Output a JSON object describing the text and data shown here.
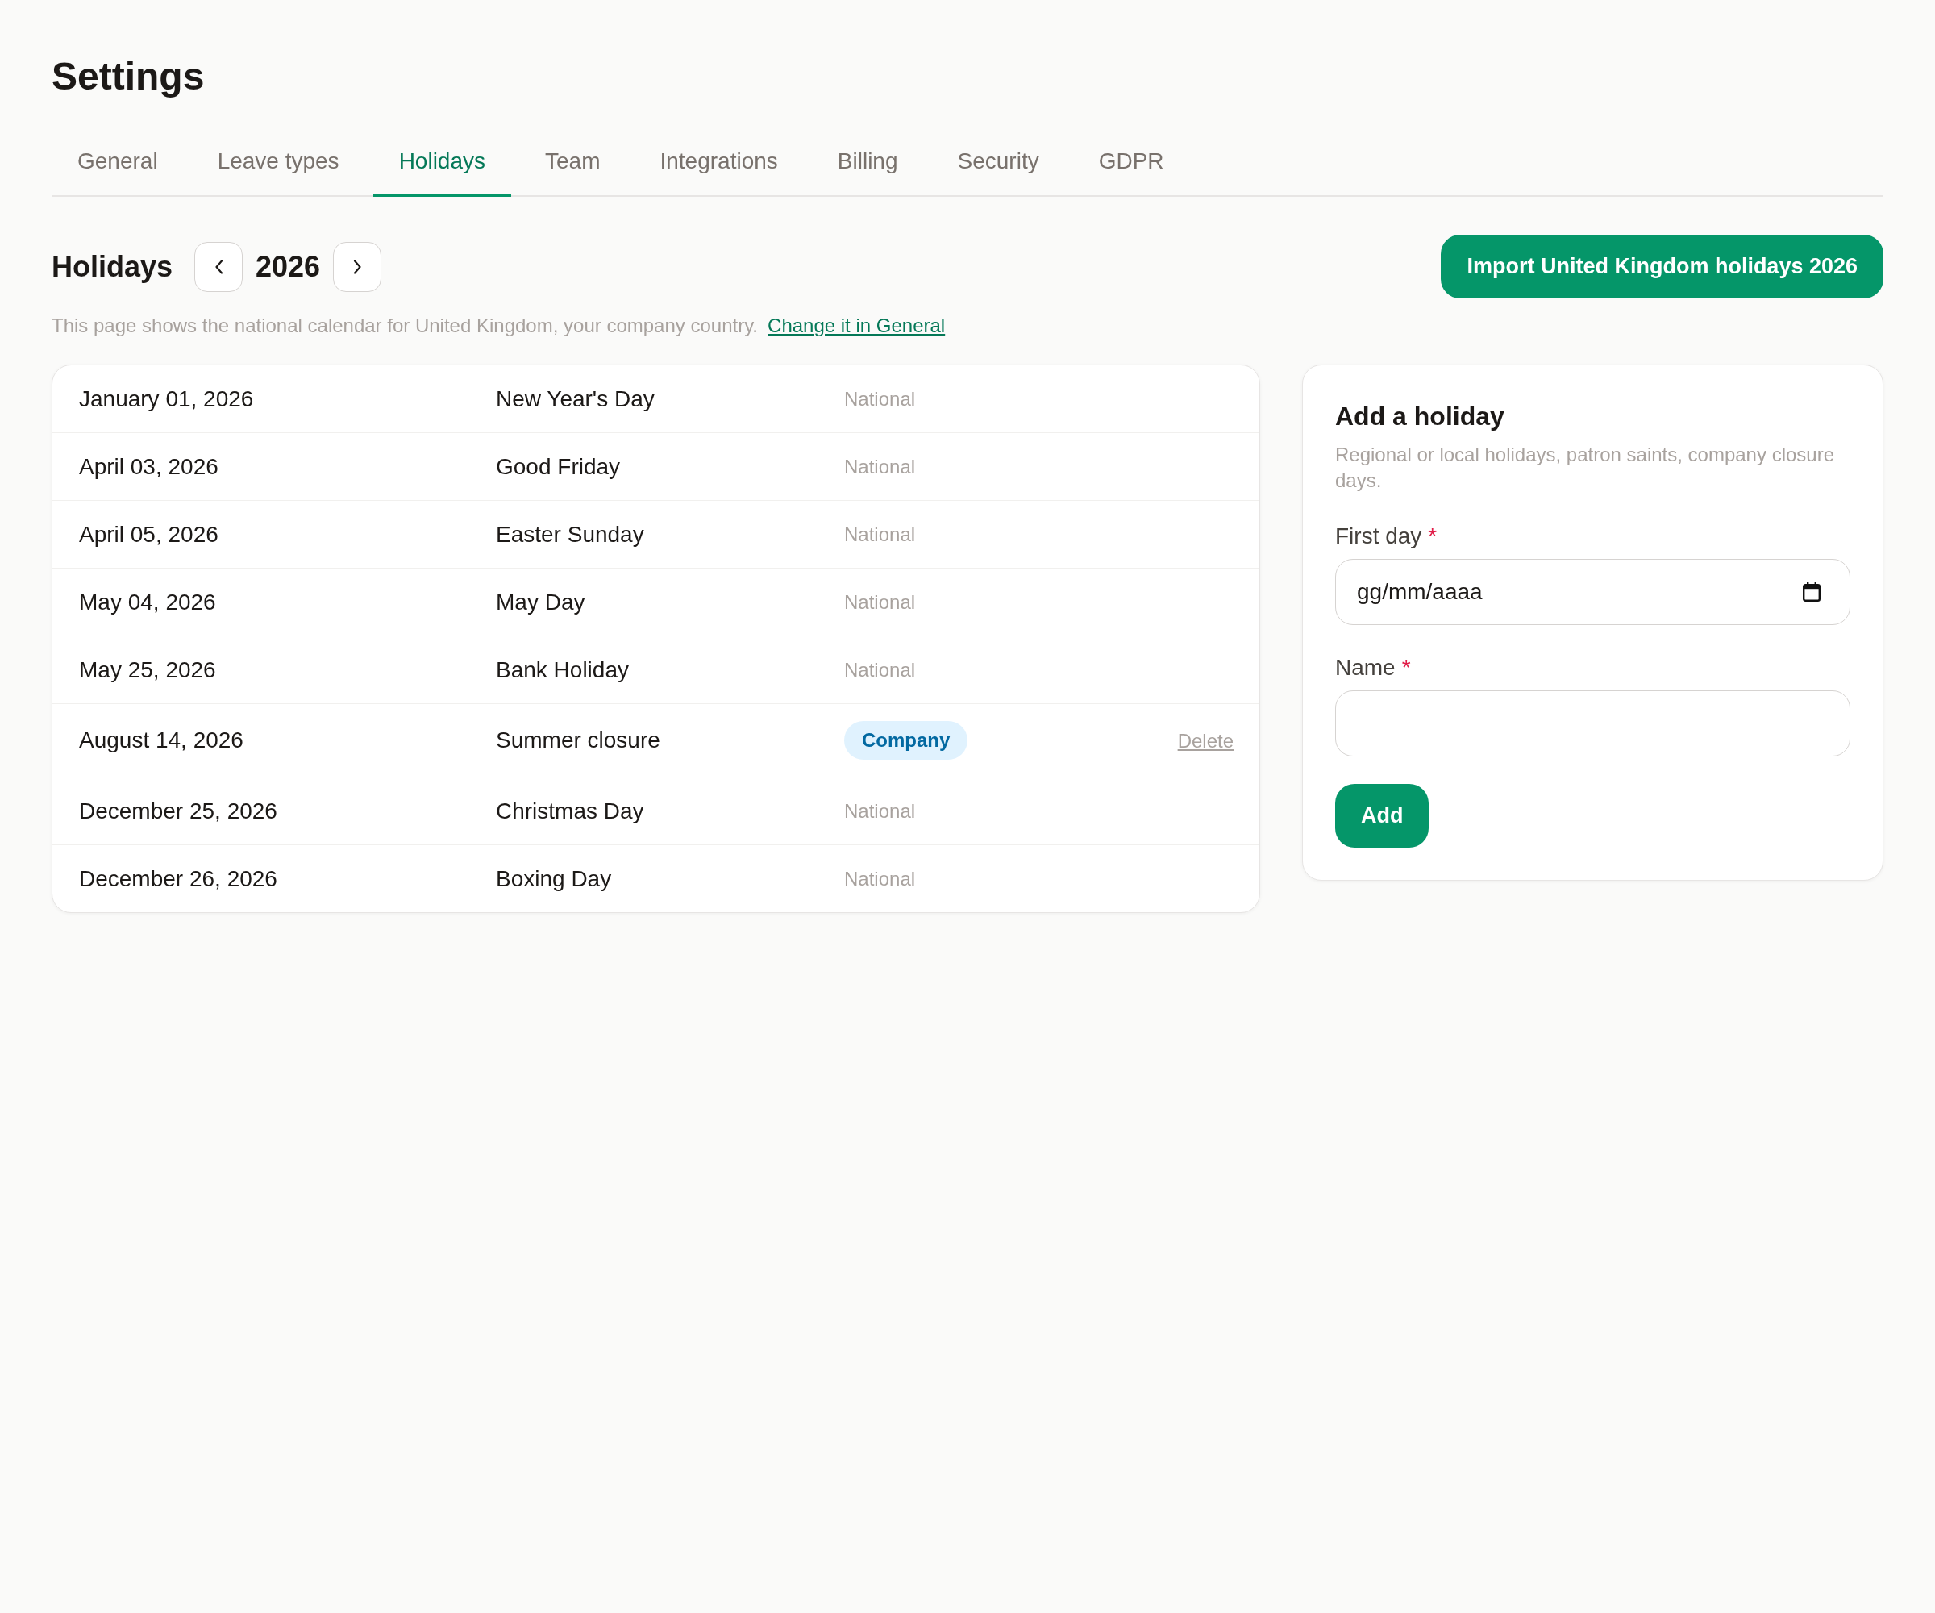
{
  "page": {
    "title": "Settings"
  },
  "tabs": [
    {
      "label": "General",
      "selected": false
    },
    {
      "label": "Leave types",
      "selected": false
    },
    {
      "label": "Holidays",
      "selected": true
    },
    {
      "label": "Team",
      "selected": false
    },
    {
      "label": "Integrations",
      "selected": false
    },
    {
      "label": "Billing",
      "selected": false
    },
    {
      "label": "Security",
      "selected": false
    },
    {
      "label": "GDPR",
      "selected": false
    }
  ],
  "holidays_header": {
    "title": "Holidays",
    "year": "2026",
    "import_button": "Import United Kingdom holidays 2026"
  },
  "notice": {
    "text": "This page shows the national calendar for United Kingdom, your company country.",
    "link": "Change it in General"
  },
  "holidays": [
    {
      "date": "January 01, 2026",
      "name": "New Year's Day",
      "type": "National",
      "kind": "national"
    },
    {
      "date": "April 03, 2026",
      "name": "Good Friday",
      "type": "National",
      "kind": "national"
    },
    {
      "date": "April 05, 2026",
      "name": "Easter Sunday",
      "type": "National",
      "kind": "national"
    },
    {
      "date": "May 04, 2026",
      "name": "May Day",
      "type": "National",
      "kind": "national"
    },
    {
      "date": "May 25, 2026",
      "name": "Bank Holiday",
      "type": "National",
      "kind": "national"
    },
    {
      "date": "August 14, 2026",
      "name": "Summer closure",
      "type": "Company",
      "kind": "company",
      "action": "Delete"
    },
    {
      "date": "December 25, 2026",
      "name": "Christmas Day",
      "type": "National",
      "kind": "national"
    },
    {
      "date": "December 26, 2026",
      "name": "Boxing Day",
      "type": "National",
      "kind": "national"
    }
  ],
  "add_form": {
    "title": "Add a holiday",
    "description": "Regional or local holidays, patron saints, company closure days.",
    "fields": [
      {
        "label": "First day",
        "required_mark": "*",
        "kind": "date",
        "placeholder": "gg/mm/aaaa"
      },
      {
        "label": "Name",
        "required_mark": "*",
        "kind": "text"
      }
    ],
    "submit": "Add"
  }
}
